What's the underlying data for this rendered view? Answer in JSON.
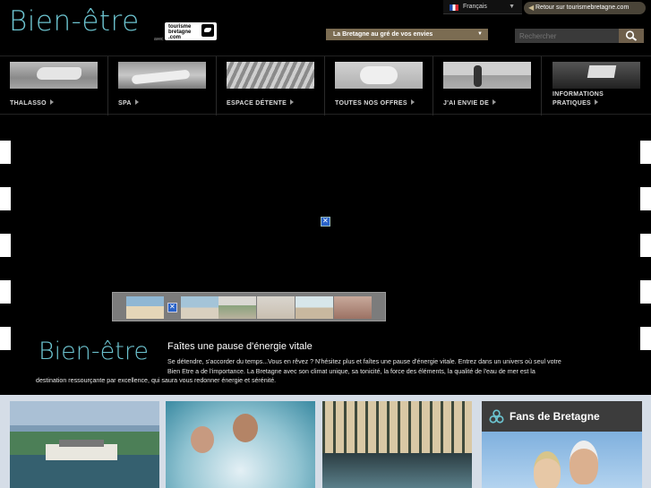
{
  "header": {
    "logo": "Bien-être",
    "partner_avec": "avec",
    "partner_logo_text": "tourisme bretagne .com",
    "language": "Français",
    "back_link": "Retour sur tourismebretagne.com",
    "selector_label": "La Bretagne au gré de vos envies",
    "search_placeholder": "Rechercher"
  },
  "nav": {
    "items": [
      {
        "label": "THALASSO"
      },
      {
        "label": "SPA"
      },
      {
        "label": "ESPACE DÉTENTE"
      },
      {
        "label": "TOUTES NOS OFFRES"
      },
      {
        "label": "J'AI ENVIE DE"
      },
      {
        "label_line1": "INFORMATIONS",
        "label_line2": "PRATIQUES"
      }
    ]
  },
  "hero": {
    "logo": "Bien-être",
    "title": "Faîtes une pause d'énergie vitale",
    "text_line1": "Se détendre, s'accorder du temps...Vous en rêvez ? N'hésitez plus et faîtes une pause d'énergie vitale. Entrez dans un univers où seul votre",
    "text_line2": "Bien Etre a de l'importance. La Bretagne avec son climat unique, sa tonicité, la force des éléments, la qualité de l'eau de mer est la",
    "text_line3": "destination ressourçante  par excellence, qui saura vous redonner énergie et sérénité."
  },
  "fans": {
    "title": "Fans de Bretagne"
  },
  "colors": {
    "accent": "#6cc3cf",
    "brown": "#7b6c52",
    "bottom_bg": "#d5dde7"
  }
}
